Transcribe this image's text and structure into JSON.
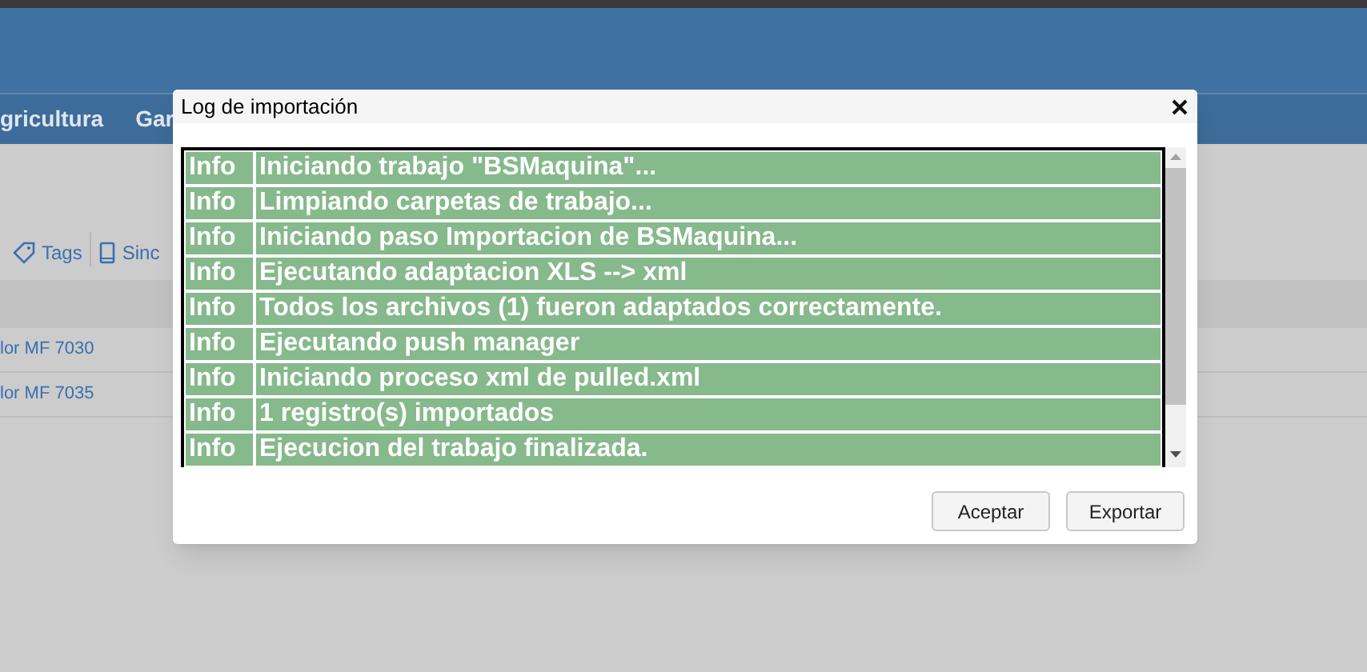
{
  "page": {
    "nav_items": [
      "gricultura",
      "Gar"
    ],
    "toolbar": [
      {
        "kind": "tag",
        "label": "Tags"
      },
      {
        "kind": "device",
        "label": "Sinc"
      }
    ],
    "rows": [
      "lor MF 7030",
      "lor MF 7035"
    ]
  },
  "dialog": {
    "title": "Log de importación",
    "log": [
      {
        "level": "Info",
        "message": "Iniciando trabajo \"BSMaquina\"..."
      },
      {
        "level": "Info",
        "message": "Limpiando carpetas de trabajo..."
      },
      {
        "level": "Info",
        "message": "Iniciando paso Importacion de BSMaquina..."
      },
      {
        "level": "Info",
        "message": "Ejecutando adaptacion XLS --> xml"
      },
      {
        "level": "Info",
        "message": "Todos los archivos (1) fueron adaptados correctamente."
      },
      {
        "level": "Info",
        "message": "Ejecutando push manager"
      },
      {
        "level": "Info",
        "message": "Iniciando proceso xml de pulled.xml"
      },
      {
        "level": "Info",
        "message": "1 registro(s) importados"
      },
      {
        "level": "Info",
        "message": "Ejecucion del trabajo finalizada."
      }
    ],
    "buttons": [
      "Aceptar",
      "Exportar"
    ]
  }
}
